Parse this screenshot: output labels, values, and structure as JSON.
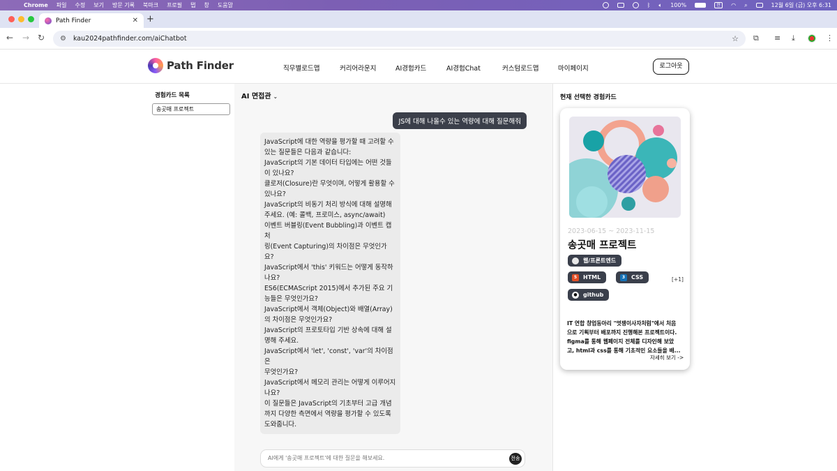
{
  "os_menu": {
    "app": "Chrome",
    "items": [
      "파일",
      "수정",
      "보기",
      "방문 기록",
      "북마크",
      "프로필",
      "탭",
      "창",
      "도움말"
    ],
    "battery": "100%",
    "input_source": "한",
    "datetime": "12월 6일 (금) 오후 6:31"
  },
  "browser": {
    "tab_title": "Path Finder",
    "url": "kau2024pathfinder.com/aiChatbot"
  },
  "site": {
    "logo_text": "Path Finder",
    "nav": [
      "직무별로드맵",
      "커리어라운지",
      "AI경험카드",
      "AI경험Chat",
      "커스텀로드맵",
      "마이페이지"
    ],
    "logout": "로그아웃"
  },
  "sidebar": {
    "title": "경험카드 목록",
    "items": [
      "송곳매 프로젝트"
    ]
  },
  "chat": {
    "mode": "AI 면접관",
    "user_message": "JS에 대해 나올수 있는 역량에 대해 질문해줘",
    "ai_lines": [
      "JavaScript에 대한 역량을 평가할 때 고려할 수",
      "있는 질문들은 다음과 같습니다:",
      "JavaScript의 기본 데이터 타입에는 어떤 것들",
      "이 있나요?",
      "클로저(Closure)란 무엇이며, 어떻게 활용할 수",
      "있나요?",
      "JavaScript의 비동기 처리 방식에 대해 설명해",
      "주세요. (예: 콜백, 프로미스, async/await)",
      "이벤트 버블링(Event Bubbling)과 이벤트 캡처",
      "링(Event Capturing)의 차이점은 무엇인가요?",
      "JavaScript에서 'this' 키워드는 어떻게 동작하",
      "나요?",
      "ES6(ECMAScript 2015)에서 추가된 주요 기",
      "능들은 무엇인가요?",
      "JavaScript에서 객체(Object)와 배열(Array)",
      "의 차이점은 무엇인가요?",
      "JavaScript의 프로토타입 기반 상속에 대해 설",
      "명해 주세요.",
      "JavaScript에서 'let', 'const', 'var'의 차이점은",
      "무엇인가요?",
      "JavaScript에서 메모리 관리는 어떻게 이루어지",
      "나요?",
      "이 질문들은 JavaScript의 기초부터 고급 개념",
      "까지 다양한 측면에서 역량을 평가할 수 있도록",
      "도와줍니다."
    ],
    "input_placeholder": "AI에게 '송곳매 프로젝트'에 대한 질문을 해보세요.",
    "send_label": "전송"
  },
  "panel": {
    "title": "현재 선택한 경험카드",
    "card": {
      "dates": "2023-06-15 ~ 2023-11-15",
      "name": "송곳매 프로젝트",
      "category": "웹/프론트엔드",
      "skills": [
        "HTML",
        "CSS",
        "github"
      ],
      "more": "[+1]",
      "description_lines": [
        "IT 연합 창업동아리 \"멋쟁이사자처럼\"에서 처음",
        "으로 기획부터 배포까지 진행해본 프로젝트이다.",
        "figma를 통해 웹페이지 전체를 디자인해 보았",
        "고, html과 css를 통해 기초적인 요소들을 배..."
      ],
      "detail_link": "자세히 보기 ->"
    }
  },
  "colors": {
    "user_bubble": "#3b3f4a",
    "ai_bubble": "#ebebeb",
    "badge": "#3a3f4b",
    "chat_bg": "#f7f7f7"
  }
}
